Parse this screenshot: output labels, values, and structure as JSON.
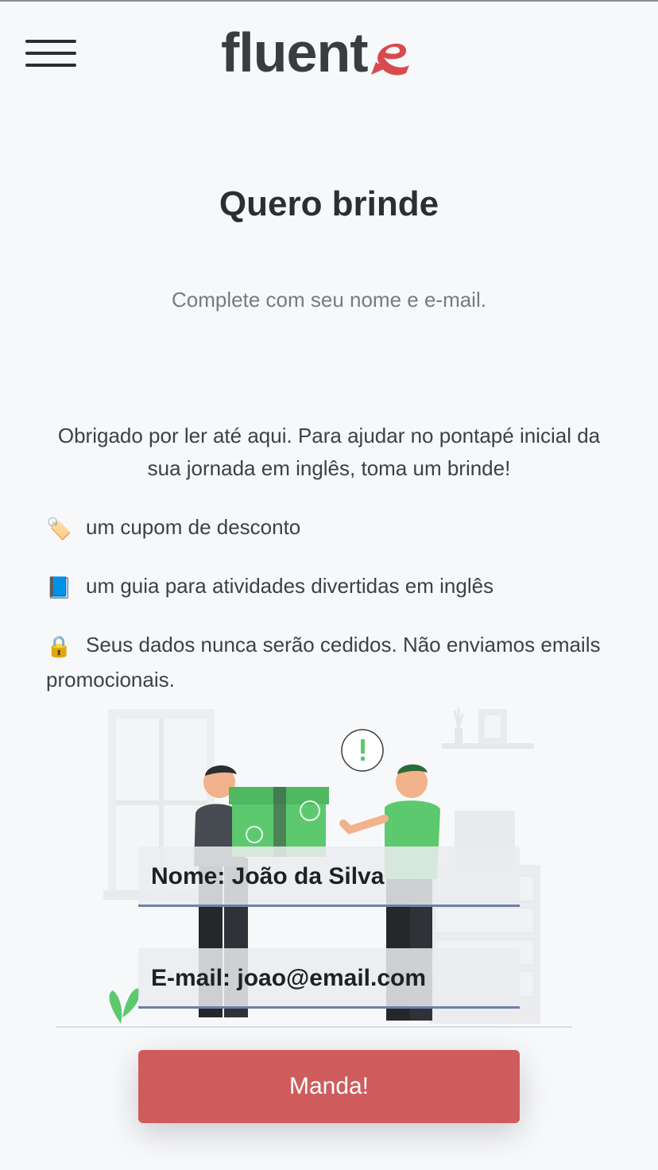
{
  "header": {
    "menu_icon": "hamburger-icon",
    "logo_text": "fluent",
    "logo_mark": "stylized-e-speech-bubble",
    "brand_color": "#d94a4f"
  },
  "page": {
    "title": "Quero brinde",
    "subtitle": "Complete com seu nome e e-mail.",
    "intro": "Obrigado por ler até aqui. Para ajudar no pontapé inicial da sua jornada em inglês, toma um brinde!"
  },
  "benefits": [
    {
      "icon": "tag-icon",
      "glyph": "🏷️",
      "text": "um cupom de desconto"
    },
    {
      "icon": "book-icon",
      "glyph": "📘",
      "text": "um guia para atividades divertidas em inglês"
    },
    {
      "icon": "lock-icon",
      "glyph": "🔒",
      "text": "Seus dados nunca serão cedidos. Não enviamos emails promocionais."
    }
  ],
  "form": {
    "name_placeholder": "Nome: João da Silva",
    "email_placeholder": "E-mail: joao@email.com",
    "submit_label": "Manda!",
    "button_color": "#cf5c5c"
  },
  "colors": {
    "background": "#f7f8fa",
    "shirt_green": "#5cc96e",
    "dark": "#2a2d31"
  }
}
